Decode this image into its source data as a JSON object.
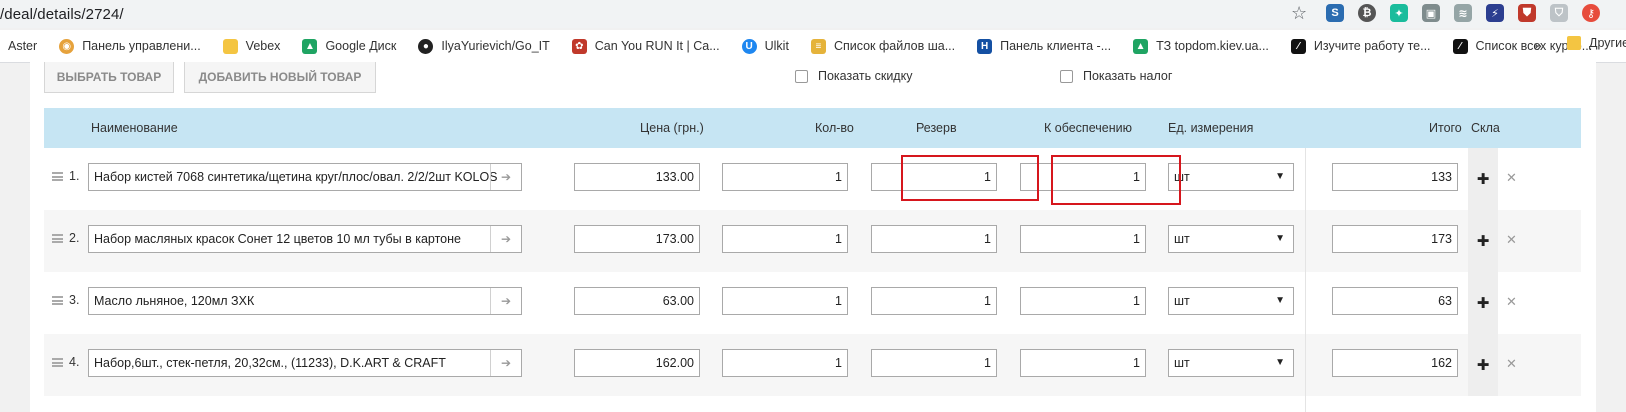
{
  "browser": {
    "url": "/deal/details/2724/",
    "bookmarks": [
      {
        "label": "Aster",
        "icon": "none",
        "color": ""
      },
      {
        "label": "Панель управлени...",
        "icon": "panel-icon",
        "color": "#e6a23c"
      },
      {
        "label": "Vebex",
        "icon": "folder-icon",
        "color": "#f4c542"
      },
      {
        "label": "Google Диск",
        "icon": "google-drive-icon",
        "color": "#1fa463"
      },
      {
        "label": "IlyaYurievich/Go_IT",
        "icon": "github-icon",
        "color": "#222222"
      },
      {
        "label": "Can You RUN It | Ca...",
        "icon": "canyourunit-icon",
        "color": "#c0392b"
      },
      {
        "label": "Ulkit",
        "icon": "ulkit-icon",
        "color": "#1e87f0"
      },
      {
        "label": "Список файлов ша...",
        "icon": "file-list-icon",
        "color": "#e5b33b"
      },
      {
        "label": "Панель клиента -...",
        "icon": "hosting-h-icon",
        "color": "#1450a3"
      },
      {
        "label": "ТЗ topdom.kiev.ua...",
        "icon": "google-drive-icon",
        "color": "#1fa463"
      },
      {
        "label": "Изучите работу те...",
        "icon": "code-icon",
        "color": "#111111"
      },
      {
        "label": "Список всех курсо...",
        "icon": "code-icon",
        "color": "#111111"
      }
    ],
    "more_label": "»",
    "other_bookmarks": "Другие"
  },
  "toolbar": {
    "select_product": "ВЫБРАТЬ ТОВАР",
    "add_new_product": "ДОБАВИТЬ НОВЫЙ ТОВАР",
    "show_discount": "Показать скидку",
    "show_tax": "Показать налог"
  },
  "table": {
    "headers": {
      "name": "Наименование",
      "price": "Цена (грн.)",
      "qty": "Кол-во",
      "reserve": "Резерв",
      "to_supply": "К обеспечению",
      "unit": "Ед. измерения",
      "total": "Итого",
      "warehouse": "Скла"
    },
    "rows": [
      {
        "num": "1.",
        "name": "Набор кистей 7068 синтетика/щетина круг/плос/овал. 2/2/2шт KOLOS",
        "price": "133.00",
        "qty": "1",
        "reserve": "1",
        "to_supply": "1",
        "unit": "шт",
        "total": "133"
      },
      {
        "num": "2.",
        "name": "Набор масляных красок Сонет 12 цветов 10 мл тубы в картоне",
        "price": "173.00",
        "qty": "1",
        "reserve": "1",
        "to_supply": "1",
        "unit": "шт",
        "total": "173"
      },
      {
        "num": "3.",
        "name": "Масло льняное, 120мл ЗХК",
        "price": "63.00",
        "qty": "1",
        "reserve": "1",
        "to_supply": "1",
        "unit": "шт",
        "total": "63"
      },
      {
        "num": "4.",
        "name": "Набор,6шт., стек-петля, 20,32см., (11233), D.K.ART & CRAFT",
        "price": "162.00",
        "qty": "1",
        "reserve": "1",
        "to_supply": "1",
        "unit": "шт",
        "total": "162"
      }
    ]
  },
  "colors": {
    "header_bg": "#c6e5f3",
    "highlight": "#d6161d"
  }
}
